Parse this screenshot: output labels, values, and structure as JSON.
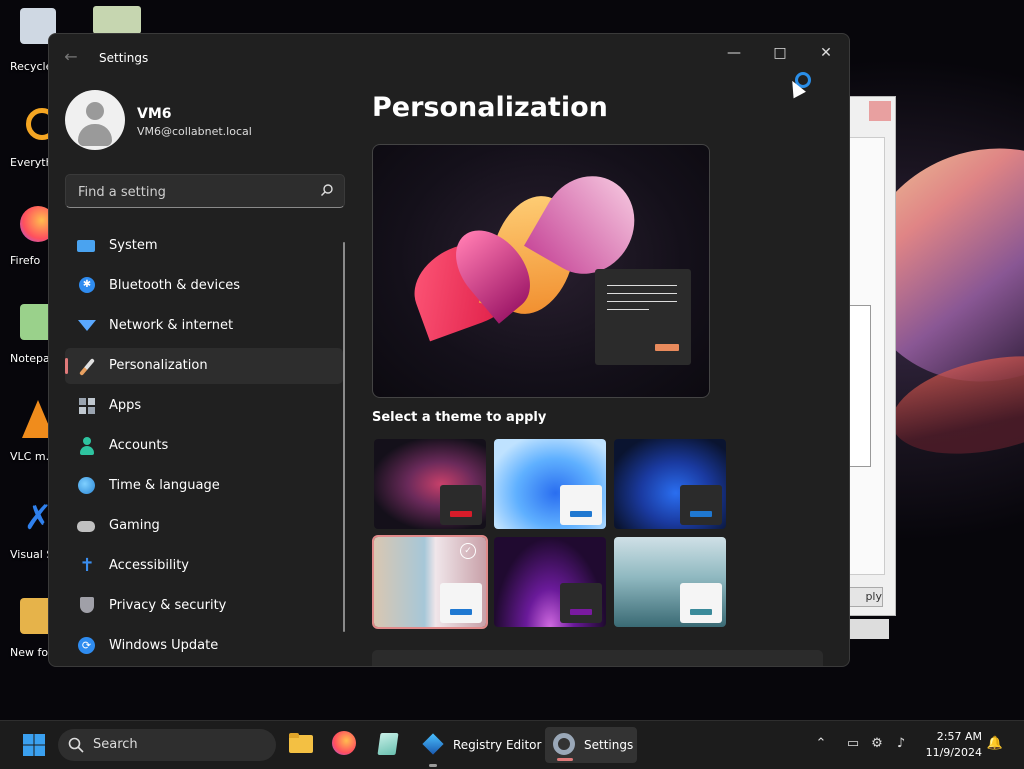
{
  "desktop": {
    "icons": [
      {
        "label": "Recycle",
        "color": "#cfd8e3"
      },
      {
        "label": "Everyth",
        "color": "#f5a623"
      },
      {
        "label": "Firefo",
        "color": "#ff7139"
      },
      {
        "label": "Notepa",
        "color": "#9ad18b"
      },
      {
        "label": "VLC m… playe",
        "color": "#f08c1c"
      },
      {
        "label": "Visual St… Cod",
        "color": "#2f80ed"
      },
      {
        "label": "New fo",
        "color": "#e6b34a"
      }
    ],
    "bg_dialog_button": "ply"
  },
  "window": {
    "title": "Settings",
    "back_icon": "back-arrow-icon",
    "min": "—",
    "max": "□",
    "close": "✕"
  },
  "profile": {
    "name": "VM6",
    "email": "VM6@collabnet.local"
  },
  "search": {
    "placeholder": "Find a setting"
  },
  "nav": {
    "items": [
      {
        "label": "System",
        "icon": "monitor-icon",
        "color": "#4aa3f0"
      },
      {
        "label": "Bluetooth & devices",
        "icon": "bluetooth-icon",
        "color": "#2f8cf0"
      },
      {
        "label": "Network & internet",
        "icon": "wifi-icon",
        "color": "#5aa8ff"
      },
      {
        "label": "Personalization",
        "icon": "paintbrush-icon",
        "color": "#e8a060"
      },
      {
        "label": "Apps",
        "icon": "apps-icon",
        "color": "#9aa4b0"
      },
      {
        "label": "Accounts",
        "icon": "person-icon",
        "color": "#2ec4a0"
      },
      {
        "label": "Time & language",
        "icon": "globe-clock-icon",
        "color": "#3aa0e0"
      },
      {
        "label": "Gaming",
        "icon": "gamepad-icon",
        "color": "#c0c0c0"
      },
      {
        "label": "Accessibility",
        "icon": "accessibility-icon",
        "color": "#3a8ef0"
      },
      {
        "label": "Privacy & security",
        "icon": "shield-icon",
        "color": "#a0a0a8"
      },
      {
        "label": "Windows Update",
        "icon": "update-icon",
        "color": "#2f8cf0"
      }
    ],
    "selected_index": 3
  },
  "content": {
    "title": "Personalization",
    "select_theme_label": "Select a theme to apply",
    "selected_theme_index": 3
  },
  "taskbar": {
    "search_label": "Search",
    "registry_label": "Registry Editor",
    "settings_label": "Settings",
    "time": "2:57 AM",
    "date": "11/9/2024"
  }
}
